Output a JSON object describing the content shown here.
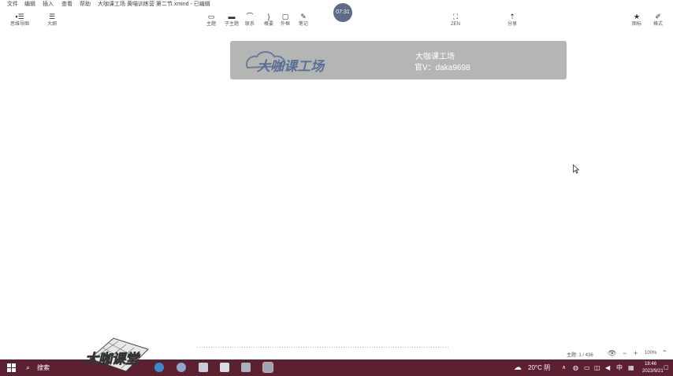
{
  "menubar": {
    "items": [
      "文件",
      "编辑",
      "插入",
      "查看",
      "帮助"
    ],
    "doc_title": "大咖课工场 黄喵训练营 第二节.xmind - 已编辑"
  },
  "timer": "07:31",
  "toolbar": {
    "left": [
      {
        "label": "思维导图",
        "icon": "mindmap-icon"
      },
      {
        "label": "大纲",
        "icon": "outline-icon"
      }
    ],
    "center": [
      {
        "label": "主题",
        "icon": "topic-icon"
      },
      {
        "label": "子主题",
        "icon": "subtopic-icon"
      },
      {
        "label": "联系",
        "icon": "relationship-icon"
      },
      {
        "label": "概要",
        "icon": "summary-icon"
      },
      {
        "label": "外框",
        "icon": "boundary-icon"
      },
      {
        "label": "笔记",
        "icon": "note-icon"
      }
    ],
    "zen": {
      "label": "ZEN",
      "icon": "zen-icon"
    },
    "share": {
      "label": "分享",
      "icon": "share-icon"
    },
    "right": [
      {
        "label": "图标",
        "icon": "star-icon"
      },
      {
        "label": "格式",
        "icon": "format-brush-icon"
      }
    ]
  },
  "banner": {
    "logo_text": "大咖课工场",
    "title": "大咖课工场",
    "contact": "官V：daka9698",
    "bg": "#b4b6b3"
  },
  "status": {
    "topic_count": "主题: 1 / 436",
    "zoom": "100%"
  },
  "watermark": {
    "text": "大咖课堂"
  },
  "taskbar": {
    "search_label": "搜索",
    "weather": "20°C 阴",
    "ime": "中",
    "time": "18:46",
    "date": "2023/9/21",
    "bg": "#5c2131"
  }
}
